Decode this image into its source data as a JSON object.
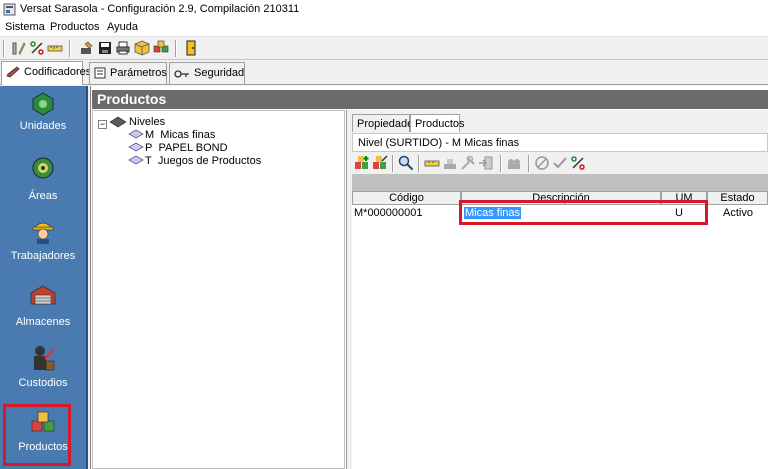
{
  "window": {
    "title": "Versat Sarasola - Configuración 2.9,  Compilación 210311"
  },
  "menu": {
    "items": [
      "Sistema",
      "Productos",
      "Ayuda"
    ]
  },
  "top_tabs": [
    {
      "label": "Codificadores",
      "icon": "pencil-icon",
      "active": true
    },
    {
      "label": "Parámetros",
      "icon": "notepad-icon",
      "active": false
    },
    {
      "label": "Seguridad",
      "icon": "key-icon",
      "active": false
    }
  ],
  "left_nav": {
    "items": [
      {
        "label": "Unidades",
        "icon": "unidades-icon"
      },
      {
        "label": "Áreas",
        "icon": "areas-icon"
      },
      {
        "label": "Trabajadores",
        "icon": "worker-icon"
      },
      {
        "label": "Almacenes",
        "icon": "warehouse-icon"
      },
      {
        "label": "Custodios",
        "icon": "custodian-icon"
      },
      {
        "label": "Productos",
        "icon": "products-icon",
        "selected": true
      }
    ]
  },
  "main": {
    "header": "Productos",
    "tree": {
      "root": "Niveles",
      "children": [
        {
          "code": "M",
          "label": "Micas finas"
        },
        {
          "code": "P",
          "label": "PAPEL BOND"
        },
        {
          "code": "T",
          "label": "Juegos de Productos"
        }
      ]
    },
    "inner_tabs": [
      "Propiedades",
      "Productos"
    ],
    "nivel_label": "Nivel (SURTIDO) - M  Micas finas",
    "grid": {
      "columns": [
        "Código",
        "Descripción",
        "UM",
        "Estado"
      ],
      "rows": [
        {
          "codigo": "M*000000001",
          "descripcion": "Micas finas",
          "um": "U",
          "estado": "Activo"
        }
      ]
    }
  },
  "colors": {
    "nav_background": "#4a7bb0",
    "highlight_red": "#d6192a",
    "selection_blue": "#3399ff",
    "header_gray": "#6b6b6b"
  }
}
